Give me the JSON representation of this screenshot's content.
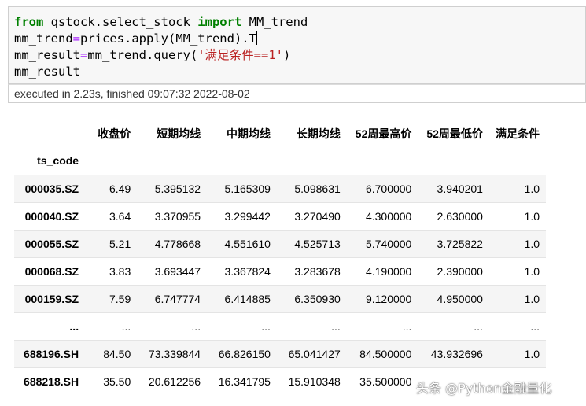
{
  "code_cell": {
    "line1": {
      "from": "from",
      "module": " qstock.select_stock ",
      "import": "import",
      "name": " MM_trend"
    },
    "line2": {
      "lhs": "mm_trend",
      "eq": "=",
      "rhs": "prices.apply(MM_trend).T"
    },
    "line3": {
      "lhs": "mm_result",
      "eq": "=",
      "rhs_a": "mm_trend.query(",
      "string": "'满足条件==1'",
      "rhs_b": ")"
    },
    "line4": "mm_result",
    "status": "executed in 2.23s, finished 09:07:32 2022-08-02"
  },
  "dataframe": {
    "columns": [
      "收盘价",
      "短期均线",
      "中期均线",
      "长期均线",
      "52周最高价",
      "52周最低价",
      "满足条件"
    ],
    "index_name": "ts_code",
    "rows": [
      {
        "index": "000035.SZ",
        "values": [
          "6.49",
          "5.395132",
          "5.165309",
          "5.098631",
          "6.700000",
          "3.940201",
          "1.0"
        ]
      },
      {
        "index": "000040.SZ",
        "values": [
          "3.64",
          "3.370955",
          "3.299442",
          "3.270490",
          "4.300000",
          "2.630000",
          "1.0"
        ]
      },
      {
        "index": "000055.SZ",
        "values": [
          "5.21",
          "4.778668",
          "4.551610",
          "4.525713",
          "5.740000",
          "3.725822",
          "1.0"
        ]
      },
      {
        "index": "000068.SZ",
        "values": [
          "3.83",
          "3.693447",
          "3.367824",
          "3.283678",
          "4.190000",
          "2.390000",
          "1.0"
        ]
      },
      {
        "index": "000159.SZ",
        "values": [
          "7.59",
          "6.747774",
          "6.414885",
          "6.350930",
          "9.120000",
          "4.950000",
          "1.0"
        ]
      },
      {
        "index": "...",
        "values": [
          "...",
          "...",
          "...",
          "...",
          "...",
          "...",
          "..."
        ]
      },
      {
        "index": "688196.SH",
        "values": [
          "84.50",
          "73.339844",
          "66.826150",
          "65.041427",
          "84.500000",
          "43.932696",
          "1.0"
        ]
      },
      {
        "index": "688218.SH",
        "values": [
          "35.50",
          "20.612256",
          "16.341795",
          "15.910348",
          "35.500000",
          "",
          ""
        ]
      }
    ]
  },
  "watermark": "头条 @Python金融量化"
}
